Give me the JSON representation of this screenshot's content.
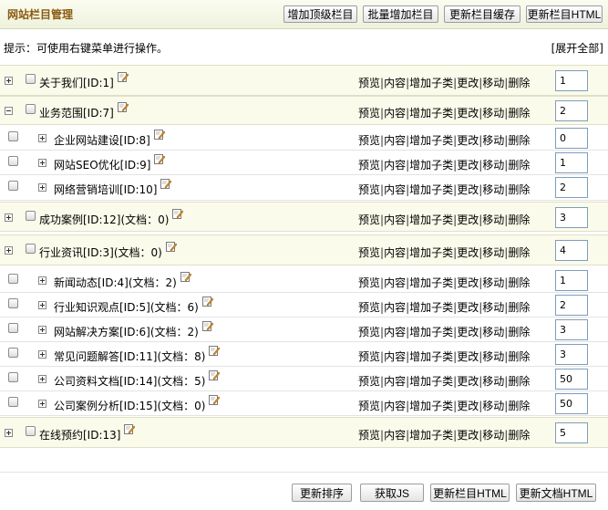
{
  "header": {
    "title": "网站栏目管理",
    "buttons": [
      "增加顶级栏目",
      "批量增加栏目",
      "更新栏目缓存",
      "更新栏目HTML"
    ]
  },
  "hint": "提示：可使用右键菜单进行操作。",
  "expand_all": "[展开全部]",
  "actions": [
    "预览",
    "内容",
    "增加子类",
    "更改",
    "移动",
    "删除"
  ],
  "action_sep": "|",
  "rows": [
    {
      "name": "关于我们[ID:1]",
      "order": "1",
      "level": 0,
      "expand": "plus"
    },
    {
      "name": "业务范围[ID:7]",
      "order": "2",
      "level": 0,
      "expand": "minus"
    },
    {
      "name": "企业网站建设[ID:8]",
      "order": "0",
      "level": 1,
      "expand": "plus"
    },
    {
      "name": "网站SEO优化[ID:9]",
      "order": "1",
      "level": 1,
      "expand": "plus"
    },
    {
      "name": "网络营销培训[ID:10]",
      "order": "2",
      "level": 1,
      "expand": "plus"
    },
    {
      "name": "成功案例[ID:12](文档：0)",
      "order": "3",
      "level": 0,
      "expand": "plus"
    },
    {
      "name": "行业资讯[ID:3](文档：0)",
      "order": "4",
      "level": 0,
      "expand": "plus"
    },
    {
      "name": "新闻动态[ID:4](文档：2)",
      "order": "1",
      "level": 1,
      "expand": "plus"
    },
    {
      "name": "行业知识观点[ID:5](文档：6)",
      "order": "2",
      "level": 1,
      "expand": "plus"
    },
    {
      "name": "网站解决方案[ID:6](文档：2)",
      "order": "3",
      "level": 1,
      "expand": "plus"
    },
    {
      "name": "常见问题解答[ID:11](文档：8)",
      "order": "3",
      "level": 1,
      "expand": "plus"
    },
    {
      "name": "公司资料文档[ID:14](文档：5)",
      "order": "50",
      "level": 1,
      "expand": "plus"
    },
    {
      "name": "公司案例分析[ID:15](文档：0)",
      "order": "50",
      "level": 1,
      "expand": "plus"
    },
    {
      "name": "在线预约[ID:13]",
      "order": "5",
      "level": 0,
      "expand": "plus"
    }
  ],
  "footer": {
    "buttons": [
      "更新排序",
      "获取JS",
      "更新栏目HTML",
      "更新文档HTML"
    ]
  }
}
